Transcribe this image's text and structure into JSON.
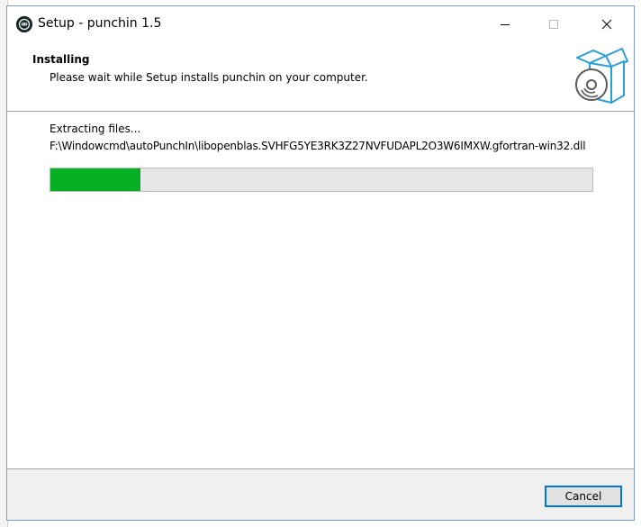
{
  "window": {
    "title": "Setup - punchin 1.5",
    "icon": "punchin-app-icon",
    "controls": {
      "minimize_icon": "minimize-icon",
      "maximize_icon": "maximize-icon",
      "close_icon": "close-icon"
    }
  },
  "header": {
    "title": "Installing",
    "subtitle": "Please wait while Setup installs punchin on your computer.",
    "icon": "software-box-cd-icon"
  },
  "content": {
    "status": "Extracting files...",
    "current_file": "F:\\Windowcmd\\autoPunchIn\\libopenblas.SVHFG5YE3RK3Z27NVFUDAPL2O3W6IMXW.gfortran-win32.dll",
    "progress_fraction": 0.166
  },
  "footer": {
    "cancel_label": "Cancel"
  },
  "colors": {
    "progress_fill": "#06b025",
    "progress_track": "#e6e6e6",
    "accent": "#0078d7",
    "icon_blue": "#2a9fd6",
    "footer_bg": "#f0f0f0"
  }
}
